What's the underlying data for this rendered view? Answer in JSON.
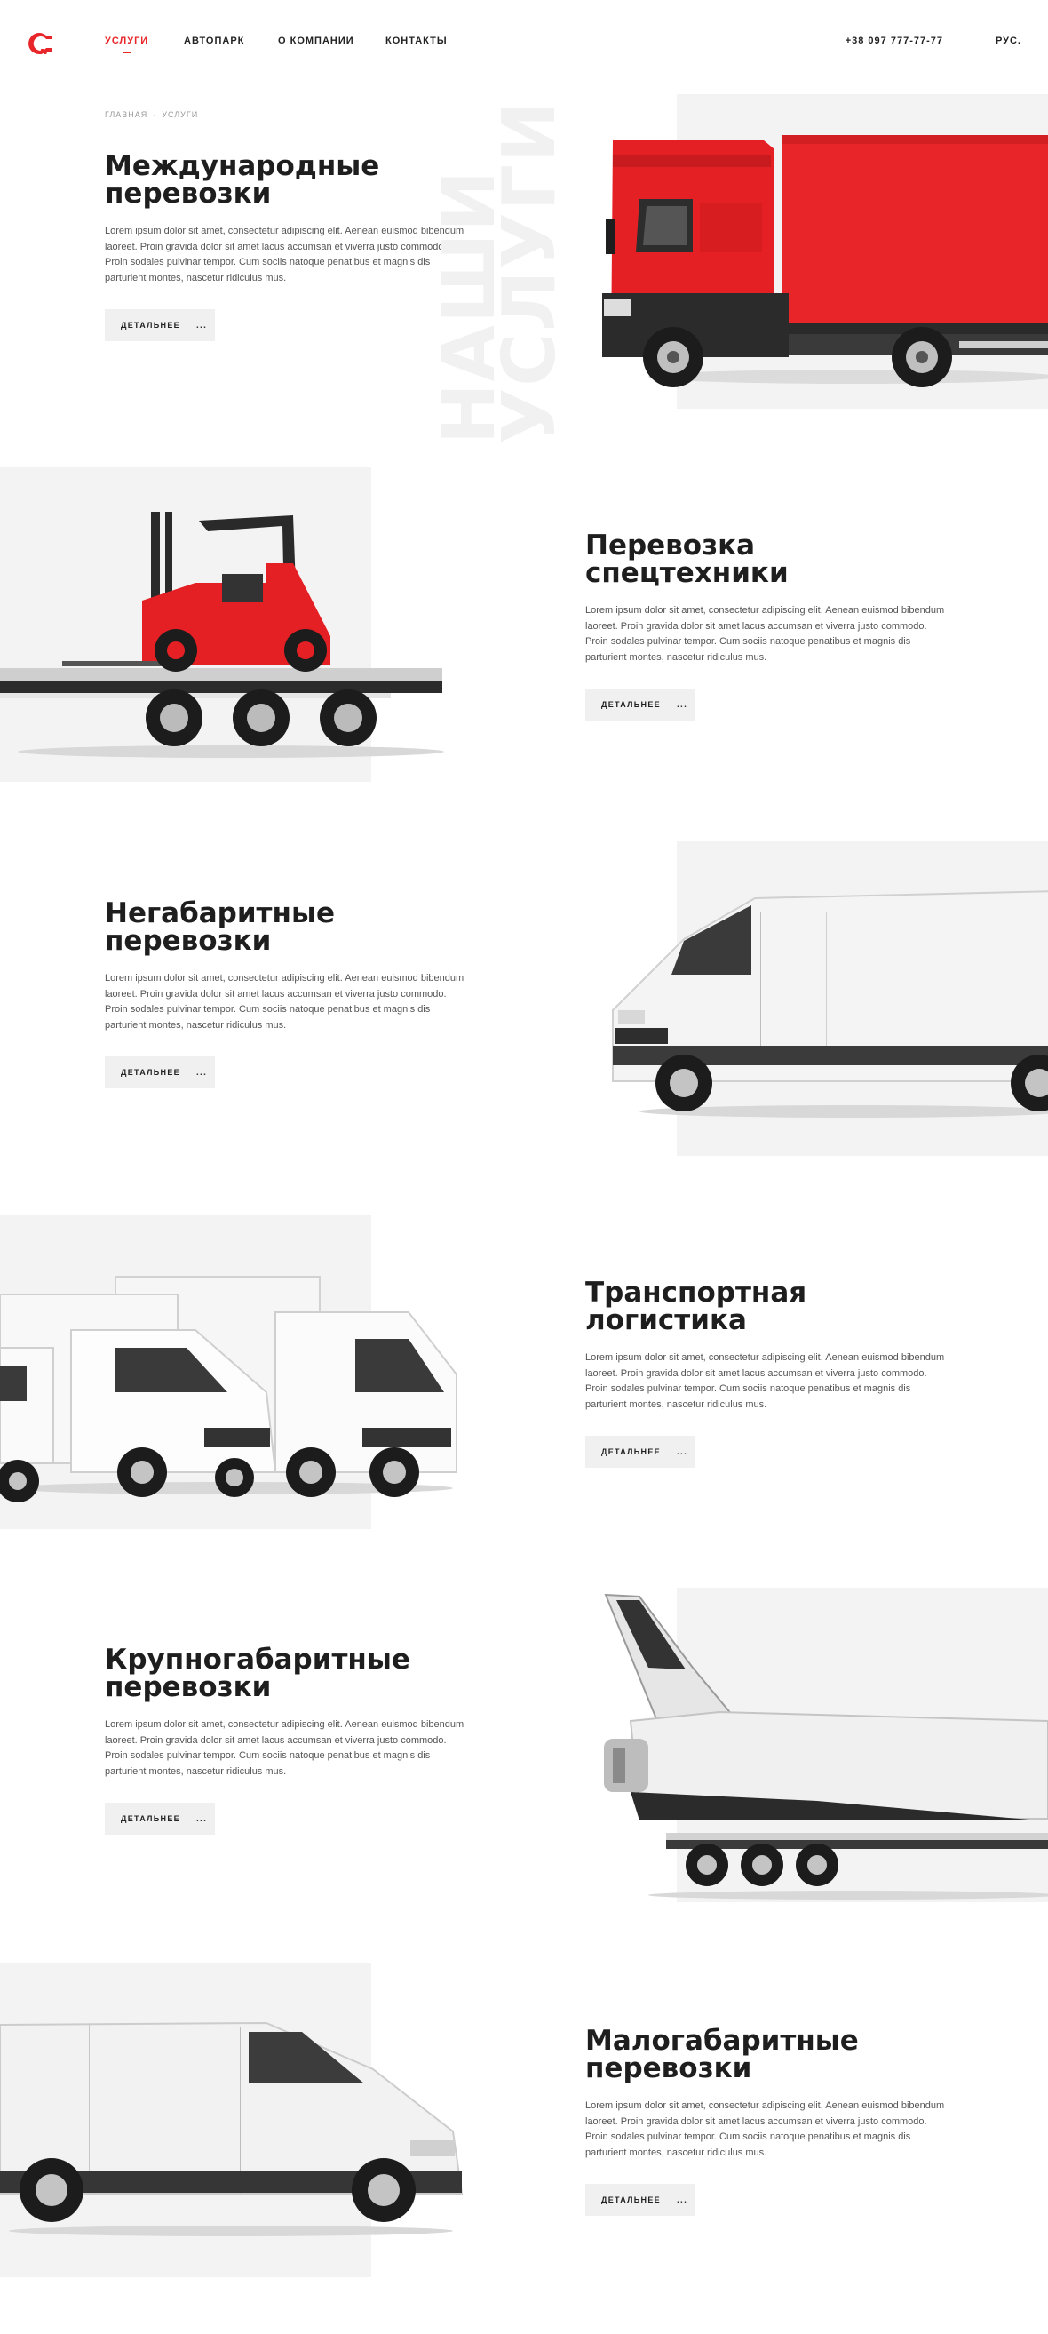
{
  "header": {
    "nav": [
      {
        "label": "УСЛУГИ",
        "active": true
      },
      {
        "label": "АВТОПАРК",
        "active": false
      },
      {
        "label": "О КОМПАНИИ",
        "active": false
      },
      {
        "label": "КОНТАКТЫ",
        "active": false
      }
    ],
    "phone": "+38 097 777-77-77",
    "lang": "РУС."
  },
  "breadcrumb": [
    "ГЛАВНАЯ",
    "УСЛУГИ"
  ],
  "watermark": [
    "НАШИ",
    "УСЛУГИ"
  ],
  "services": [
    {
      "title_line1": "Международные",
      "title_line2": "перевозки",
      "vehicle": "red-box-truck-icon",
      "description": "Lorem ipsum dolor sit amet, consectetur adipiscing elit. Aenean euismod bibendum laoreet. Proin gravida dolor sit amet lacus accumsan et viverra justo commodo. Proin sodales pulvinar tempor. Cum sociis natoque penatibus et magnis dis parturient montes, nascetur ridiculus mus.",
      "button": "ДЕТАЛЬНЕЕ",
      "button_dots": "..."
    },
    {
      "title_line1": "Перевозка",
      "title_line2": "спецтехники",
      "vehicle": "forklift-on-trailer-icon",
      "description": "Lorem ipsum dolor sit amet, consectetur adipiscing elit. Aenean euismod bibendum laoreet. Proin gravida dolor sit amet lacus accumsan et viverra justo commodo. Proin sodales pulvinar tempor. Cum sociis natoque penatibus et magnis dis parturient montes, nascetur ridiculus mus.",
      "button": "ДЕТАЛЬНЕЕ",
      "button_dots": "..."
    },
    {
      "title_line1": "Негабаритные",
      "title_line2": "перевозки",
      "vehicle": "white-van-icon",
      "description": "Lorem ipsum dolor sit amet, consectetur adipiscing elit. Aenean euismod bibendum laoreet. Proin gravida dolor sit amet lacus accumsan et viverra justo commodo. Proin sodales pulvinar tempor. Cum sociis natoque penatibus et magnis dis parturient montes, nascetur ridiculus mus.",
      "button": "ДЕТАЛЬНЕЕ",
      "button_dots": "..."
    },
    {
      "title_line1": "Транспортная",
      "title_line2": "логистика",
      "vehicle": "white-trucks-icon",
      "description": "Lorem ipsum dolor sit amet, consectetur adipiscing elit. Aenean euismod bibendum laoreet. Proin gravida dolor sit amet lacus accumsan et viverra justo commodo. Proin sodales pulvinar tempor. Cum sociis natoque penatibus et magnis dis parturient montes, nascetur ridiculus mus.",
      "button": "ДЕТАЛЬНЕЕ",
      "button_dots": "..."
    },
    {
      "title_line1": "Крупногабаритные",
      "title_line2": "перевозки",
      "vehicle": "space-shuttle-trailer-icon",
      "description": "Lorem ipsum dolor sit amet, consectetur adipiscing elit. Aenean euismod bibendum laoreet. Proin gravida dolor sit amet lacus accumsan et viverra justo commodo. Proin sodales pulvinar tempor. Cum sociis natoque penatibus et magnis dis parturient montes, nascetur ridiculus mus.",
      "button": "ДЕТАЛЬНЕЕ",
      "button_dots": "..."
    },
    {
      "title_line1": "Малогабаритные",
      "title_line2": "перевозки",
      "vehicle": "white-minivan-icon",
      "description": "Lorem ipsum dolor sit amet, consectetur adipiscing elit. Aenean euismod bibendum laoreet. Proin gravida dolor sit amet lacus accumsan et viverra justo commodo. Proin sodales pulvinar tempor. Cum sociis natoque penatibus et magnis dis parturient montes, nascetur ridiculus mus.",
      "button": "ДЕТАЛЬНЕЕ",
      "button_dots": "..."
    }
  ],
  "colors": {
    "accent": "#e8262a",
    "panel": "#f3f3f3",
    "text": "#1e1e1e"
  }
}
